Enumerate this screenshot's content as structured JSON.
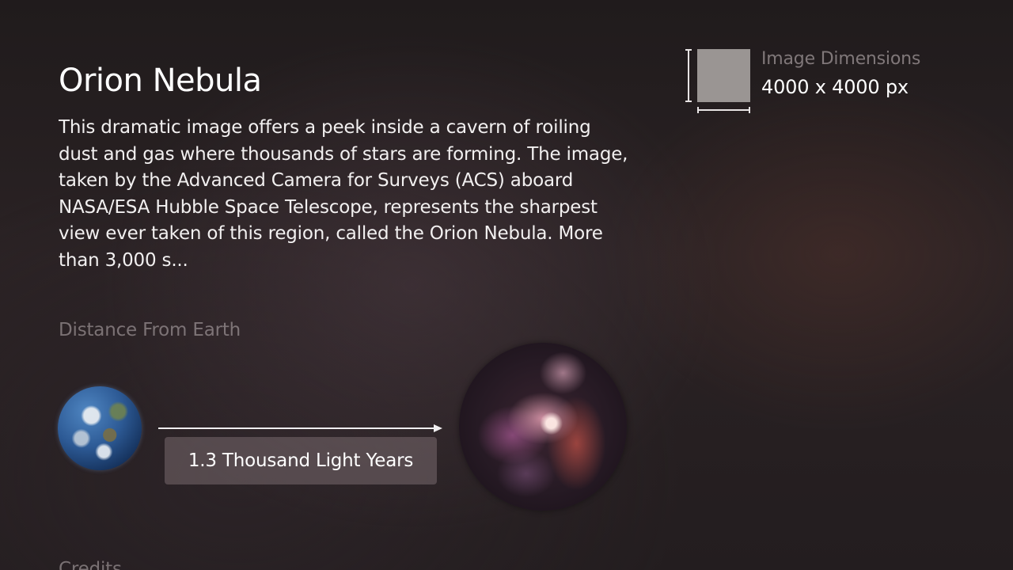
{
  "title": "Orion Nebula",
  "description": "This dramatic image offers a peek inside a cavern of roiling dust and gas where thousands of stars are forming. The image, taken by the Advanced Camera for Surveys (ACS) aboard NASA/ESA Hubble Space Telescope, represents the sharpest view ever taken of this region, called the Orion Nebula. More than 3,000 s...",
  "image_dimensions": {
    "label": "Image Dimensions",
    "value": "4000 x 4000 px",
    "icon": "dimensions-icon"
  },
  "distance": {
    "label": "Distance From Earth",
    "value": "1.3 Thousand Light Years",
    "origin_icon": "earth-image",
    "target_icon": "nebula-thumbnail"
  },
  "credits": {
    "label": "Credits"
  },
  "colors": {
    "background": "#2a2224",
    "secondary_text": "#beb4b6",
    "distance_box": "#786e6e"
  }
}
